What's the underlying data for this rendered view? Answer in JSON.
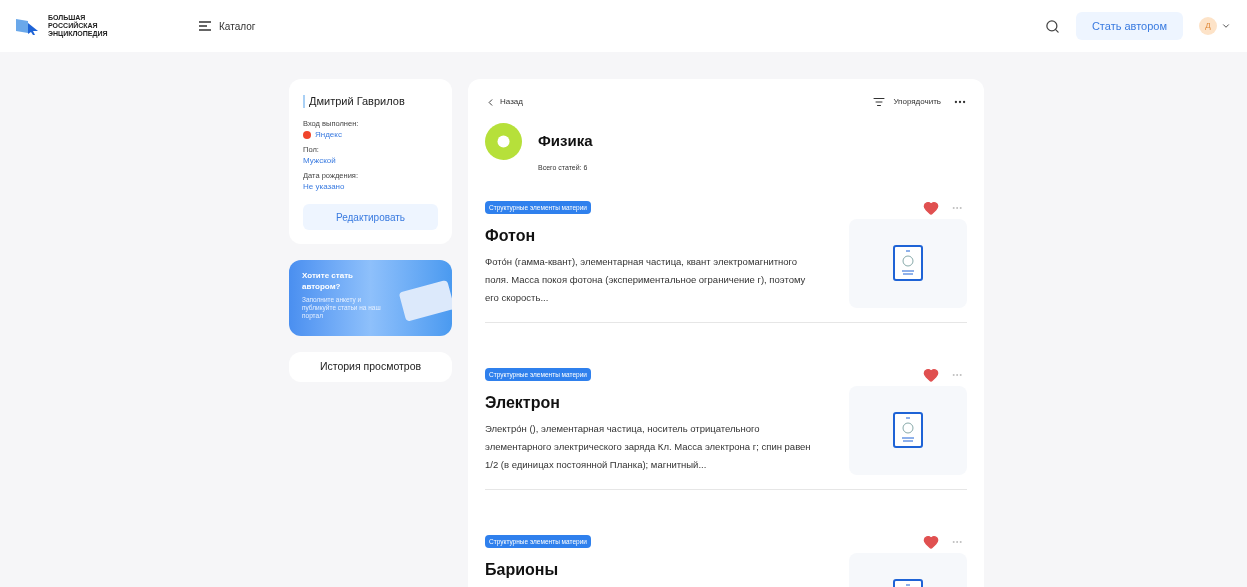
{
  "header": {
    "logo_lines": [
      "БОЛЬШАЯ",
      "РОССИЙСКАЯ",
      "ЭНЦИКЛОПЕДИЯ"
    ],
    "catalog": "Каталог",
    "become_author": "Стать автором",
    "avatar": "Д"
  },
  "profile": {
    "name": "Дмитрий Гаврилов",
    "fields": [
      {
        "label": "Вход выполнен:",
        "value": "Яндекс",
        "kind": "provider"
      },
      {
        "label": "Пол:",
        "value": "Мужской",
        "kind": "plain"
      },
      {
        "label": "Дата рождения:",
        "value": "Не указано",
        "kind": "plain"
      }
    ],
    "edit": "Редактировать"
  },
  "promo": {
    "title": "Хотите стать автором?",
    "text": "Заполните анкету и публикуйте статьи на наш портал"
  },
  "history": "История просмотров",
  "main": {
    "back": "Назад",
    "sort": "Упорядочить",
    "title": "Физика",
    "count": "Всего статей: 6",
    "articles": [
      {
        "tag": "Структурные элементы материи",
        "liked": true,
        "title": "Фотон",
        "excerpt": "Фото́н (гамма-квант), элементарная частица, квант электромагнитного поля. Масса покоя фотона (экспериментальное ограничение  г), поэтому его скорость..."
      },
      {
        "tag": "Структурные элементы материи",
        "liked": true,
        "title": "Электрон",
        "excerpt": "Электро́н (), элементарная частица, носитель отрицательного элементарного электрического заряда Кл. Масса электрона г; спин равен 1/2 (в единицах постоянной Планка); магнитный..."
      },
      {
        "tag": "Структурные элементы материи",
        "liked": true,
        "title": "Барионы"
      }
    ]
  }
}
